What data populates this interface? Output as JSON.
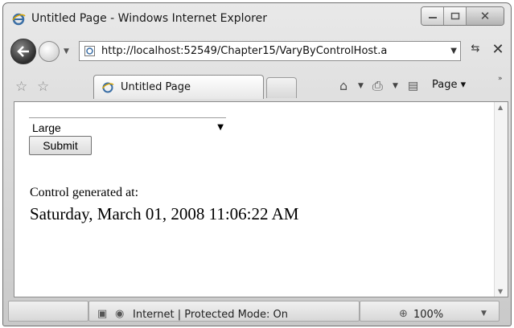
{
  "window": {
    "title": "Untitled Page - Windows Internet Explorer"
  },
  "address_bar": {
    "url": "http://localhost:52549/Chapter15/VaryByControlHost.a"
  },
  "tab": {
    "label": "Untitled Page"
  },
  "toolbar": {
    "page_menu": "Page"
  },
  "form": {
    "select_value": "Large",
    "submit_label": "Submit"
  },
  "output": {
    "label": "Control generated at:",
    "timestamp": "Saturday, March 01, 2008 11:06:22 AM"
  },
  "status": {
    "zone": "Internet | Protected Mode: On",
    "zoom": "100%"
  },
  "icons": [
    "ie-logo-icon",
    "minimize-icon",
    "maximize-icon",
    "close-icon",
    "back-icon",
    "forward-icon",
    "page-favicon",
    "refresh-icon",
    "stop-icon",
    "favorites-star-icon",
    "add-favorites-icon",
    "home-icon",
    "print-icon",
    "page-icon",
    "globe-icon",
    "zoom-icon"
  ]
}
